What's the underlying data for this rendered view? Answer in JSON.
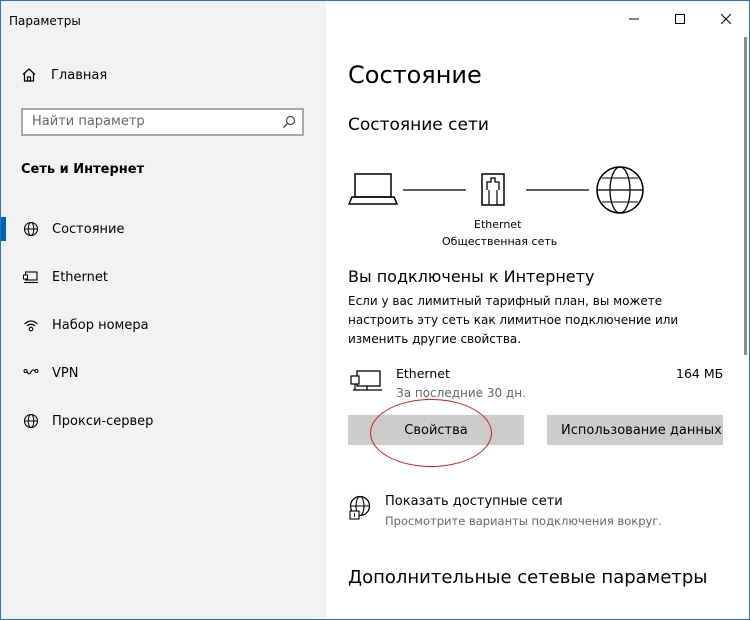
{
  "window": {
    "title": "Параметры"
  },
  "sidebar": {
    "home_label": "Главная",
    "search_placeholder": "Найти параметр",
    "section_title": "Сеть и Интернет",
    "items": [
      {
        "label": "Состояние",
        "icon": "globe-icon",
        "selected": true
      },
      {
        "label": "Ethernet",
        "icon": "ethernet-icon",
        "selected": false
      },
      {
        "label": "Набор номера",
        "icon": "dialup-icon",
        "selected": false
      },
      {
        "label": "VPN",
        "icon": "vpn-icon",
        "selected": false
      },
      {
        "label": "Прокси-сервер",
        "icon": "globe-icon",
        "selected": false
      }
    ]
  },
  "main": {
    "title": "Состояние",
    "network_status_title": "Состояние сети",
    "diagram": {
      "adapter_name": "Ethernet",
      "network_type": "Общественная сеть"
    },
    "connected_title": "Вы подключены к Интернету",
    "description": "Если у вас лимитный тарифный план, вы можете настроить эту сеть как лимитное подключение или изменить другие свойства.",
    "adapter": {
      "name": "Ethernet",
      "period": "За последние 30 дн.",
      "data_used": "164 МБ"
    },
    "buttons": {
      "properties": "Свойства",
      "data_usage": "Использование данных"
    },
    "available_networks": {
      "title": "Показать доступные сети",
      "subtitle": "Просмотрите варианты подключения вокруг."
    },
    "advanced_title": "Дополнительные сетевые параметры"
  },
  "colors": {
    "accent": "#0063b1",
    "sidebar_bg": "#f2f2f2",
    "button_bg": "#cccccc",
    "annotation": "#cc1c1c",
    "window_border": "#2b6fc7"
  }
}
